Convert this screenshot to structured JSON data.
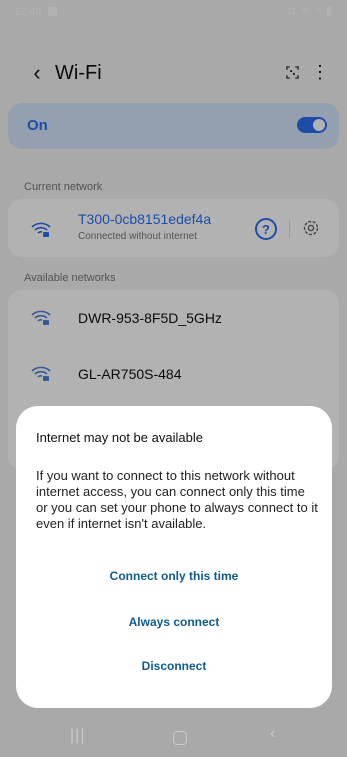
{
  "status_bar": {
    "time": "12:49",
    "icons": "◘ ✕ ◔ ▮"
  },
  "app_bar": {
    "title": "Wi-Fi"
  },
  "wifi_toggle": {
    "label": "On",
    "enabled": true
  },
  "current_network": {
    "section_title": "Current network",
    "name": "T300-0cb8151edef4a",
    "status": "Connected without internet",
    "help_symbol": "?"
  },
  "available_networks": {
    "section_title": "Available networks",
    "items": [
      {
        "name": "DWR-953-8F5D_5GHz"
      },
      {
        "name": "GL-AR750S-484"
      }
    ]
  },
  "dialog": {
    "title": "Internet may not be available",
    "body": "If you want to connect to this network without internet access, you can connect only this time or you can set your phone to always connect to it even if internet isn't available.",
    "buttons": {
      "connect_once": "Connect only this time",
      "always": "Always connect",
      "disconnect": "Disconnect"
    }
  },
  "colors": {
    "accent": "#2a6ef2",
    "dialog_button": "#0f5b8f"
  }
}
